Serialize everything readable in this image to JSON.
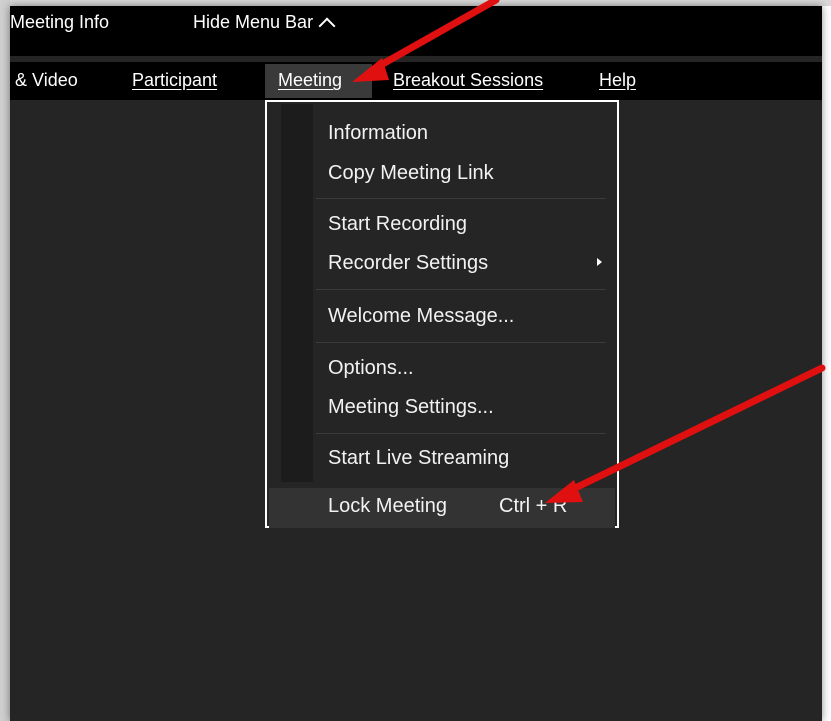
{
  "topbar": {
    "meeting_info": "Meeting Info",
    "hide_menu_bar": "Hide Menu Bar"
  },
  "menubar": {
    "audio_video": "o & Video",
    "participant": "Participant",
    "meeting": "Meeting",
    "breakout": "Breakout Sessions",
    "help": "Help"
  },
  "dropdown": {
    "information": "Information",
    "copy_link": "Copy Meeting Link",
    "start_recording": "Start Recording",
    "recorder_settings": "Recorder Settings",
    "welcome_message": "Welcome Message...",
    "options": "Options...",
    "meeting_settings": "Meeting Settings...",
    "start_live_streaming": "Start Live Streaming",
    "lock_meeting": "Lock Meeting",
    "lock_shortcut": "Ctrl + R"
  },
  "colors": {
    "window_bg": "#252525",
    "bar_bg": "#000000",
    "menu_highlight": "#3a3a3a",
    "annotation_arrow": "#e01010"
  },
  "icons": {
    "hide_menu_chevron": "chevron-up-icon",
    "submenu": "caret-right-icon",
    "annotation": "red-arrow-icon"
  }
}
